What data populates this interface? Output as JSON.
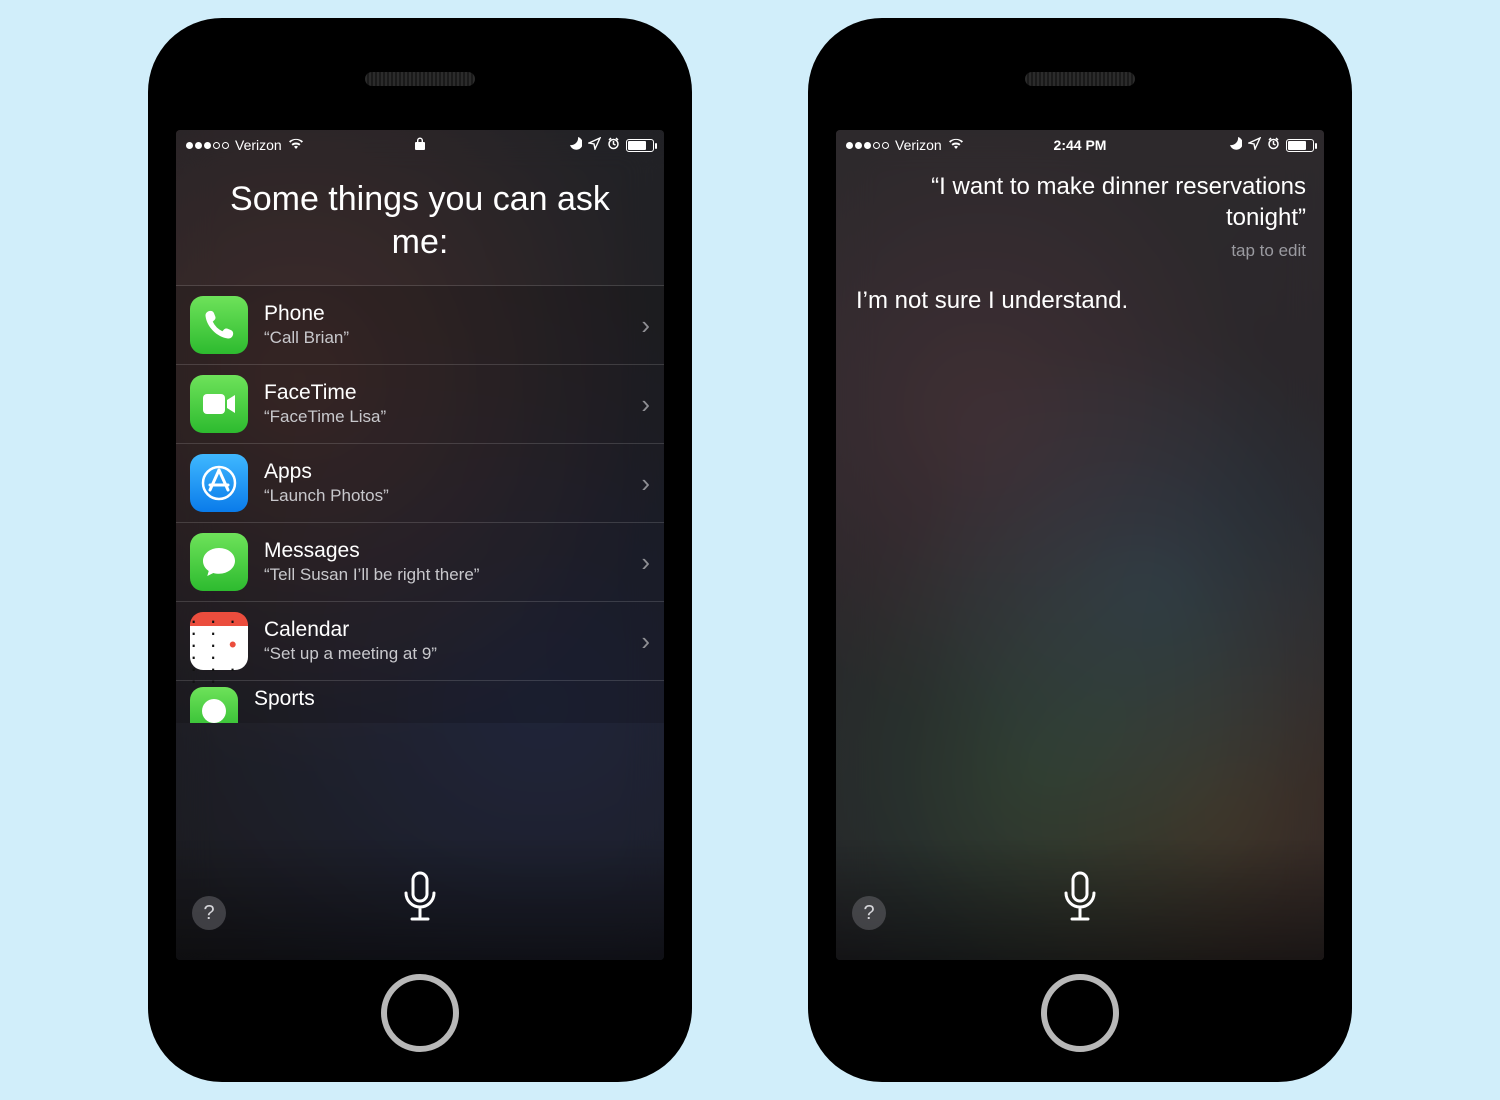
{
  "left": {
    "status": {
      "carrier": "Verizon",
      "time": "",
      "show_lock": true
    },
    "title": "Some things you can ask me:",
    "suggestions": [
      {
        "app": "Phone",
        "example": "“Call Brian”",
        "icon": "phone"
      },
      {
        "app": "FaceTime",
        "example": "“FaceTime Lisa”",
        "icon": "facetime"
      },
      {
        "app": "Apps",
        "example": "“Launch Photos”",
        "icon": "appstore"
      },
      {
        "app": "Messages",
        "example": "“Tell Susan I’ll be right there”",
        "icon": "messages"
      },
      {
        "app": "Calendar",
        "example": "“Set up a meeting at 9”",
        "icon": "calendar"
      },
      {
        "app": "Sports",
        "example": "",
        "icon": "sports"
      }
    ],
    "help_label": "?"
  },
  "right": {
    "status": {
      "carrier": "Verizon",
      "time": "2:44 PM",
      "show_lock": false
    },
    "user_query": "“I want to make dinner reservations tonight”",
    "tap_to_edit": "tap to edit",
    "siri_response": "I’m not sure I understand.",
    "help_label": "?"
  }
}
